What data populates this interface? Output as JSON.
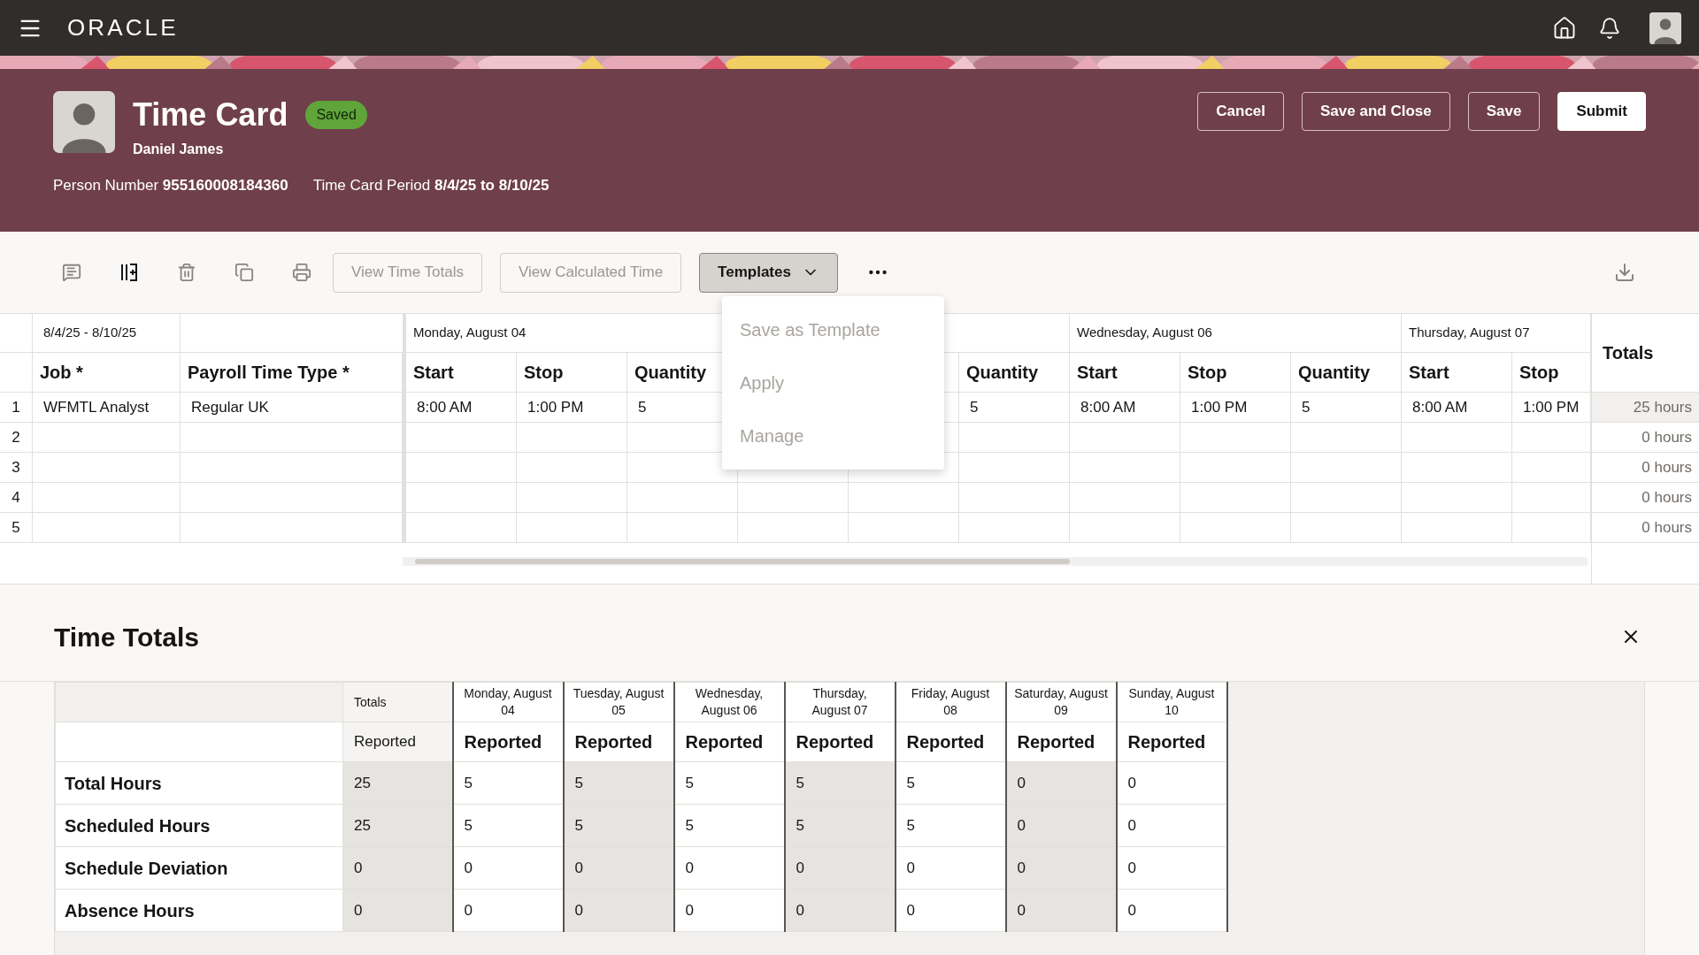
{
  "top_bar": {
    "brand": "ORACLE"
  },
  "header": {
    "title": "Time Card",
    "status": "Saved",
    "person_name": "Daniel James",
    "person_number_label": "Person Number",
    "person_number": "955160008184360",
    "period_label": "Time Card Period",
    "period": "8/4/25 to 8/10/25",
    "buttons": [
      {
        "label": "Cancel",
        "primary": false
      },
      {
        "label": "Save and Close",
        "primary": false
      },
      {
        "label": "Save",
        "primary": false
      },
      {
        "label": "Submit",
        "primary": true
      }
    ]
  },
  "toolbar": {
    "buttons": [
      {
        "label": "View Time Totals",
        "disabled": true
      },
      {
        "label": "View Calculated Time",
        "disabled": true
      }
    ],
    "templates": {
      "label": "Templates",
      "expanded": true
    }
  },
  "templates_menu": [
    {
      "label": "Save as Template",
      "disabled": true
    },
    {
      "label": "Apply",
      "disabled": true
    },
    {
      "label": "Manage",
      "disabled": true
    }
  ],
  "grid": {
    "period": "8/4/25 - 8/10/25",
    "columns": [
      "Job *",
      "Payroll Time Type *"
    ],
    "days": [
      {
        "label": "Monday, August 04",
        "columns": [
          "Start",
          "Stop",
          "Quantity"
        ]
      },
      {
        "columns": [
          "Quantity"
        ]
      },
      {
        "label": "Wednesday, August 06",
        "columns": [
          "Start",
          "Stop",
          "Quantity"
        ]
      },
      {
        "label": "Thursday, August 07",
        "columns": [
          "Start",
          "Stop"
        ]
      }
    ],
    "totals_header": "Totals",
    "rows": [
      {
        "number": "1",
        "cells": [
          "WFMTL Analyst",
          "Regular UK",
          "8:00 AM",
          "1:00 PM",
          "5",
          "5",
          "8:00 AM",
          "1:00 PM",
          "5",
          "8:00 AM",
          "1:00 PM"
        ],
        "total": "25 hours",
        "selected": true
      },
      {
        "number": "2",
        "total": "0 hours",
        "selected": false
      },
      {
        "number": "3",
        "total": "0 hours",
        "selected": false
      },
      {
        "number": "4",
        "total": "0 hours",
        "selected": false
      },
      {
        "number": "5",
        "total": "0 hours",
        "selected": false
      }
    ]
  },
  "time_totals": {
    "title": "Time Totals",
    "columns": [
      {
        "heading": "Totals",
        "subheading": "Reported",
        "kind": "totals",
        "shaded": true
      },
      {
        "heading": "Monday, August 04",
        "subheading": "Reported",
        "kind": "day",
        "shaded": false
      },
      {
        "heading": "Tuesday, August 05",
        "subheading": "Reported",
        "kind": "day",
        "shaded": true
      },
      {
        "heading": "Wednesday, August 06",
        "subheading": "Reported",
        "kind": "day",
        "shaded": false
      },
      {
        "heading": "Thursday, August 07",
        "subheading": "Reported",
        "kind": "day",
        "shaded": true
      },
      {
        "heading": "Friday, August 08",
        "subheading": "Reported",
        "kind": "day",
        "shaded": false
      },
      {
        "heading": "Saturday, August 09",
        "subheading": "Reported",
        "kind": "day",
        "shaded": true
      },
      {
        "heading": "Sunday, August 10",
        "subheading": "Reported",
        "kind": "day",
        "shaded": false
      }
    ],
    "rows": [
      {
        "label": "Total Hours",
        "values": [
          "25",
          "5",
          "5",
          "5",
          "5",
          "5",
          "0",
          "0"
        ]
      },
      {
        "label": "Scheduled Hours",
        "values": [
          "25",
          "5",
          "5",
          "5",
          "5",
          "5",
          "0",
          "0"
        ]
      },
      {
        "label": "Schedule Deviation",
        "values": [
          "0",
          "0",
          "0",
          "0",
          "0",
          "0",
          "0",
          "0"
        ]
      },
      {
        "label": "Absence Hours",
        "values": [
          "0",
          "0",
          "0",
          "0",
          "0",
          "0",
          "0",
          "0"
        ]
      }
    ]
  }
}
